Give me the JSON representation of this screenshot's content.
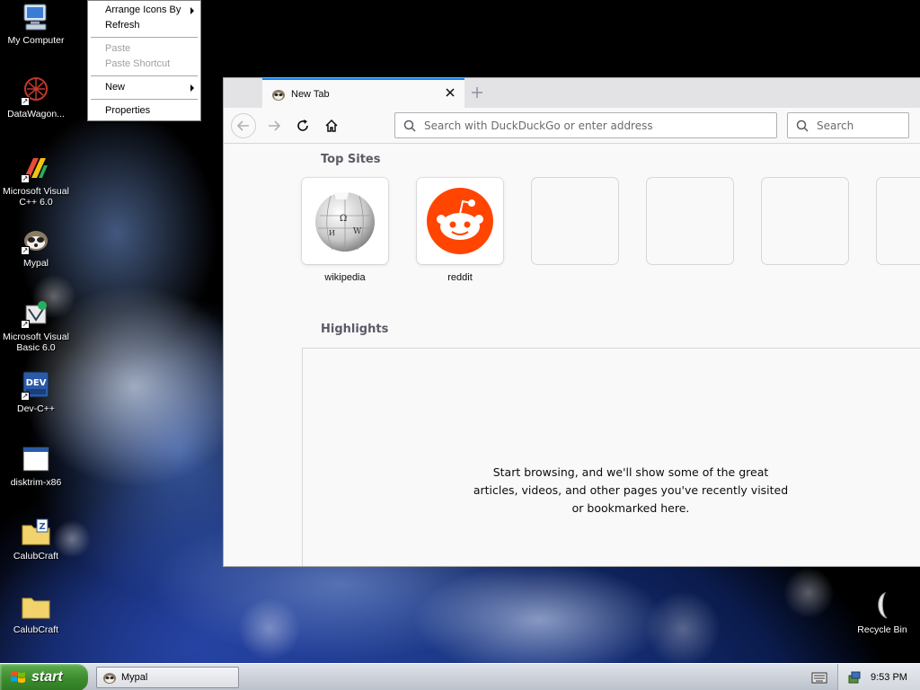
{
  "desktop": {
    "icons": [
      {
        "label": "My Computer",
        "icon": "my-computer-icon"
      },
      {
        "label": "DataWagon...",
        "icon": "datawagon-icon"
      },
      {
        "label": "Microsoft Visual C++ 6.0",
        "icon": "visual-cpp-icon"
      },
      {
        "label": "Mypal",
        "icon": "mypal-icon"
      },
      {
        "label": "Microsoft Visual Basic 6.0",
        "icon": "visual-basic-icon"
      },
      {
        "label": "Dev-C++",
        "icon": "dev-cpp-icon"
      },
      {
        "label": "disktrim-x86",
        "icon": "application-window-icon"
      },
      {
        "label": "CalubCraft",
        "icon": "zip-folder-icon"
      },
      {
        "label": "CalubCraft",
        "icon": "folder-icon"
      }
    ],
    "recycle_bin": {
      "label": "Recycle Bin",
      "icon": "recycle-bin-icon"
    }
  },
  "context_menu": {
    "arrange_icons_by": "Arrange Icons By",
    "refresh": "Refresh",
    "paste": "Paste",
    "paste_shortcut": "Paste Shortcut",
    "new": "New",
    "properties": "Properties"
  },
  "browser": {
    "tab": {
      "title": "New Tab",
      "icon": "mypal-icon"
    },
    "urlbar": {
      "placeholder": "Search with DuckDuckGo or enter address",
      "value": ""
    },
    "searchbar": {
      "placeholder": "Search",
      "value": ""
    },
    "accent_color": "#0a84ff",
    "newtab": {
      "top_sites_title": "Top Sites",
      "top_sites": [
        {
          "label": "wikipedia",
          "icon": "wikipedia-globe-icon"
        },
        {
          "label": "reddit",
          "icon": "reddit-alien-icon",
          "color": "#ff4500"
        }
      ],
      "highlights_title": "Highlights",
      "highlights_message": "Start browsing, and we'll show some of the great articles, videos, and other pages you've recently visited or bookmarked here."
    }
  },
  "taskbar": {
    "start_label": "start",
    "task_label": "Mypal",
    "clock": "9:53 PM"
  }
}
